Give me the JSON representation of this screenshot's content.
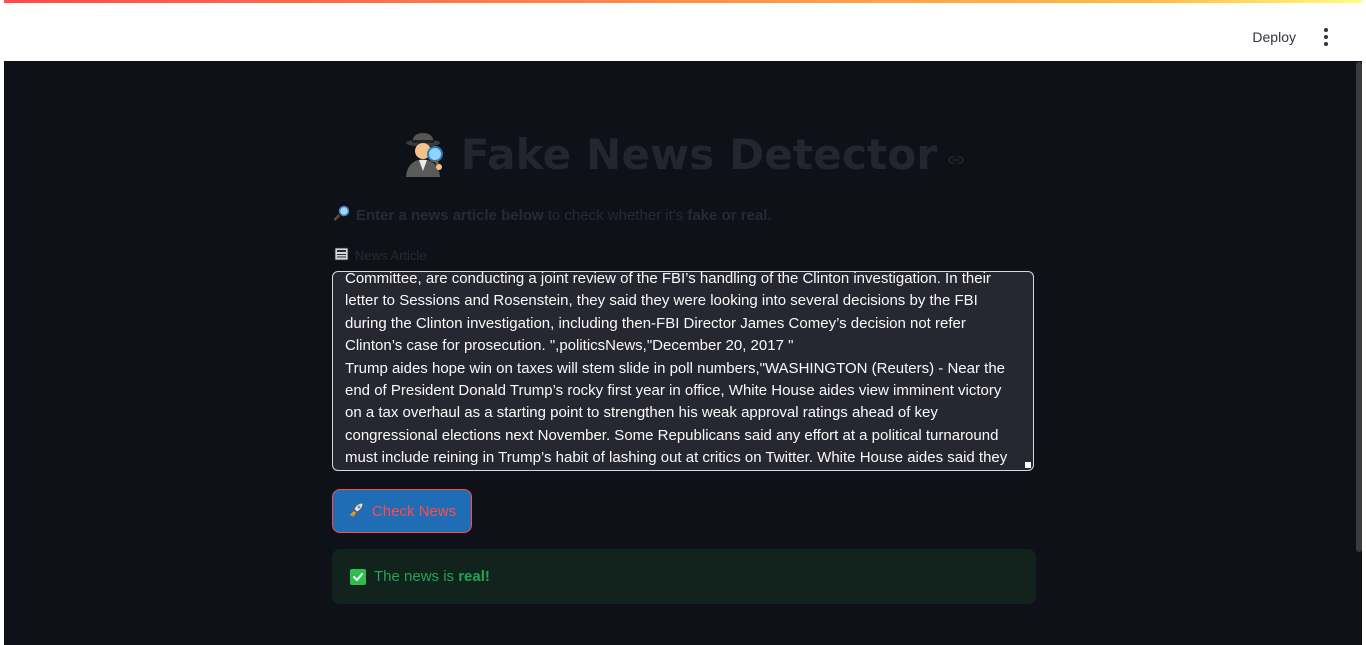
{
  "header": {
    "deploy_label": "Deploy"
  },
  "app": {
    "title": "Fake News Detector",
    "subtitle_prefix": "Enter a news article below",
    "subtitle_middle": " to check whether it's ",
    "subtitle_suffix": "fake or real.",
    "textarea_label": "News Article",
    "textarea_value": "Committee, are conducting a joint review of the FBI’s handling of the Clinton investigation. In their letter to Sessions and Rosenstein, they said they were looking into several decisions by the FBI during the Clinton investigation, including then-FBI Director James Comey’s decision not refer Clinton’s case for prosecution. \",politicsNews,\"December 20, 2017 \"\nTrump aides hope win on taxes will stem slide in poll numbers,\"WASHINGTON (Reuters) - Near the end of President Donald Trump’s rocky first year in office, White House aides view imminent victory on a tax overhaul as a starting point to strengthen his weak approval ratings ahead of key congressional elections next November. Some Republicans said any effort at a political turnaround must include reining in Trump’s habit of lashing out at critics on Twitter. White House aides said they",
    "check_button_label": "Check News",
    "result_prefix": "The news is ",
    "result_value": "real!"
  },
  "icons": {
    "title_icon": "detective-icon",
    "subtitle_icon": "magnifier-icon",
    "label_icon": "newspaper-icon",
    "button_icon": "rocket-icon",
    "result_icon": "check-mark-icon"
  },
  "colors": {
    "background": "#0e1117",
    "accent": "#ff4b4b",
    "button_bg": "#1f6eb5",
    "success_text": "#21a356",
    "success_bg": "#12231d"
  }
}
